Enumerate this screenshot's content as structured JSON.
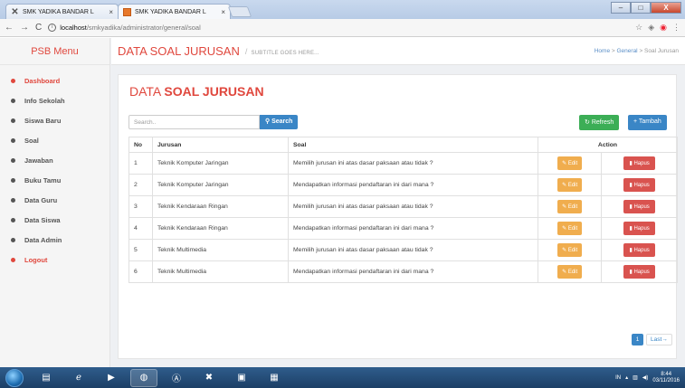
{
  "browser": {
    "tabs": [
      {
        "title": "SMK YADIKA BANDAR L",
        "close": "×"
      },
      {
        "title": "SMK YADIKA BANDAR L",
        "close": "×"
      }
    ],
    "url_host": "localhost",
    "url_path": "/smkyadika/administrator/general/soal",
    "nav": {
      "back": "←",
      "forward": "→",
      "reload": "C"
    },
    "window_controls": {
      "minimize": "–",
      "maximize": "□",
      "close": "X"
    }
  },
  "sidebar": {
    "brand": "PSB Menu",
    "items": [
      {
        "label": "Dashboard",
        "active": true
      },
      {
        "label": "Info Sekolah"
      },
      {
        "label": "Siswa Baru"
      },
      {
        "label": "Soal"
      },
      {
        "label": "Jawaban"
      },
      {
        "label": "Buku Tamu"
      },
      {
        "label": "Data Guru"
      },
      {
        "label": "Data Siswa"
      },
      {
        "label": "Data Admin"
      },
      {
        "label": "Logout",
        "active": true
      }
    ]
  },
  "header": {
    "title": "DATA SOAL JURUSAN",
    "subtitle": "SUBTITLE GOES HERE...",
    "breadcrumb": {
      "home": "Home",
      "sep1": ">",
      "section": "General",
      "sep2": ">",
      "current": "Soal Jurusan"
    }
  },
  "card": {
    "title_prefix": "DATA",
    "title_bold": "SOAL JURUSAN",
    "search_placeholder": "Search..",
    "search_button": "Search",
    "refresh_button": "Refresh",
    "add_button": "Tambah"
  },
  "table": {
    "headers": {
      "no": "No",
      "jurusan": "Jurusan",
      "soal": "Soal",
      "action": "Action"
    },
    "rows": [
      {
        "no": "1",
        "jurusan": "Teknik Komputer Jaringan",
        "soal": "Memilih jurusan ini atas dasar paksaan atau tidak ?",
        "edit": "Edit",
        "hapus": "Hapus"
      },
      {
        "no": "2",
        "jurusan": "Teknik Komputer Jaringan",
        "soal": "Mendapatkan informasi pendaftaran ini dari mana ?",
        "edit": "Edit",
        "hapus": "Hapus"
      },
      {
        "no": "3",
        "jurusan": "Teknik Kendaraan Ringan",
        "soal": "Memilih jurusan ini atas dasar paksaan atau tidak ?",
        "edit": "Edit",
        "hapus": "Hapus"
      },
      {
        "no": "4",
        "jurusan": "Teknik Kendaraan Ringan",
        "soal": "Mendapatkan informasi pendaftaran ini dari mana ?",
        "edit": "Edit",
        "hapus": "Hapus"
      },
      {
        "no": "5",
        "jurusan": "Teknik Multimedia",
        "soal": "Memilih jurusan ini atas dasar paksaan atau tidak ?",
        "edit": "Edit",
        "hapus": "Hapus"
      },
      {
        "no": "6",
        "jurusan": "Teknik Multimedia",
        "soal": "Mendapatkan informasi pendaftaran ini dari mana ?",
        "edit": "Edit",
        "hapus": "Hapus"
      }
    ]
  },
  "pagination": {
    "current": "1",
    "last": "Last"
  },
  "taskbar": {
    "lang": "IN",
    "time": "8:44",
    "date": "03/11/2016"
  },
  "colors": {
    "accent": "#e0483e",
    "primary": "#3a86c6",
    "success": "#3cae56",
    "warning": "#f0ad4e",
    "danger": "#d9534f"
  }
}
